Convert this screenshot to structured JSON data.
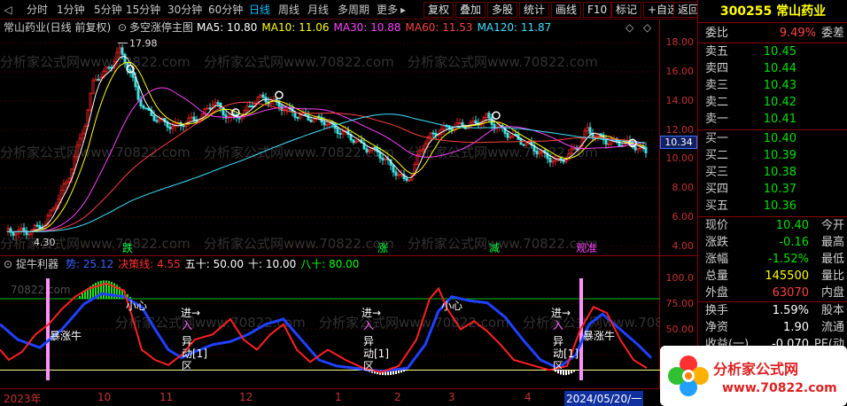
{
  "toolbar": {
    "periods": [
      "分时",
      "1分钟",
      "5分钟",
      "15分钟",
      "30分钟",
      "60分钟",
      "日线",
      "周线",
      "月线",
      "多周期",
      "更多"
    ],
    "more_arrow": "▸",
    "buttons": [
      "复权",
      "叠加",
      "多股",
      "统计",
      "画线",
      "F10",
      "标记",
      "+自选",
      "返回"
    ],
    "selected_period": "日线"
  },
  "main_chart": {
    "title": "常山药业(日线 前复权)",
    "indicator_name": "多空涨停主图",
    "ma": [
      {
        "label": "MA5:",
        "value": "10.80",
        "color": "#ffffff"
      },
      {
        "label": "MA10:",
        "value": "11.06",
        "color": "#ffff00"
      },
      {
        "label": "MA30:",
        "value": "10.88",
        "color": "#ff40ff"
      },
      {
        "label": "MA60:",
        "value": "11.53",
        "color": "#ff4040"
      },
      {
        "label": "MA120:",
        "value": "11.87",
        "color": "#40e0ff"
      }
    ],
    "price_axis": [
      "18.00",
      "16.00",
      "14.00",
      "12.00",
      "10.00",
      "8.00",
      "6.00",
      "4.00"
    ],
    "current_price_tag": "10.34",
    "high_label": "17.98",
    "low_label": "4.30",
    "markers": [
      "跌",
      "涨",
      "减",
      "观准"
    ],
    "watermark": "分析家公式网www.70822.com"
  },
  "indicator": {
    "name": "捉牛利器",
    "items": [
      {
        "label": "势:",
        "value": "25.12",
        "color": "#4060ff"
      },
      {
        "label": "决策线:",
        "value": "4.55",
        "color": "#ff3030"
      },
      {
        "label": "五十:",
        "value": "50.00",
        "color": "#ffffff"
      },
      {
        "label": "十:",
        "value": "10.00",
        "color": "#ffffff"
      },
      {
        "label": "八十:",
        "value": "80.00",
        "color": "#00ff00"
      }
    ],
    "axis": [
      "100.0",
      "75.00",
      "50.00",
      "25.00"
    ],
    "texts": {
      "bull1": "暴涨牛",
      "bull2": "暴涨牛",
      "small1": "小心",
      "small2": "小心",
      "enter1": "进→",
      "enter2": "进→",
      "enter3": "进→",
      "zone": "区",
      "yi": "异",
      "dong": "动[1]",
      "ru": "入",
      "site": "70822.com"
    }
  },
  "date_axis": [
    "2023年",
    "10",
    "11",
    "12",
    "1",
    "2",
    "3",
    "4",
    "2024/05/20/一"
  ],
  "quote": {
    "code": "300255",
    "name": "常山药业",
    "ratio_label": "委比",
    "ratio_value": "9.49%",
    "ratio_right": "委差",
    "sells": [
      {
        "label": "卖五",
        "price": "10.45"
      },
      {
        "label": "卖四",
        "price": "10.44"
      },
      {
        "label": "卖三",
        "price": "10.43"
      },
      {
        "label": "卖二",
        "price": "10.42"
      },
      {
        "label": "卖一",
        "price": "10.41"
      }
    ],
    "buys": [
      {
        "label": "买一",
        "price": "10.40"
      },
      {
        "label": "买二",
        "price": "10.39"
      },
      {
        "label": "买三",
        "price": "10.38"
      },
      {
        "label": "买四",
        "price": "10.37"
      },
      {
        "label": "买五",
        "price": "10.36"
      }
    ],
    "stats": [
      {
        "label": "现价",
        "value": "10.40",
        "right": "今开",
        "color": "#00e000"
      },
      {
        "label": "涨跌",
        "value": "-0.16",
        "right": "最高",
        "color": "#00e000"
      },
      {
        "label": "涨幅",
        "value": "-1.52%",
        "right": "最低",
        "color": "#00e000"
      },
      {
        "label": "总量",
        "value": "145500",
        "right": "量比",
        "color": "#ffff00"
      },
      {
        "label": "外盘",
        "value": "63070",
        "right": "内盘",
        "color": "#ff4040"
      }
    ],
    "stats2": [
      {
        "label": "换手",
        "value": "1.59%",
        "right": "股本",
        "color": "#ffffff"
      },
      {
        "label": "净资",
        "value": "1.90",
        "right": "流通",
        "color": "#ffffff"
      },
      {
        "label": "收益(一)",
        "value": "-0.070",
        "right": "PE(动",
        "color": "#ffffff"
      }
    ]
  },
  "logo": {
    "text": "分析家公式网",
    "url_text": "www.70822.com"
  }
}
